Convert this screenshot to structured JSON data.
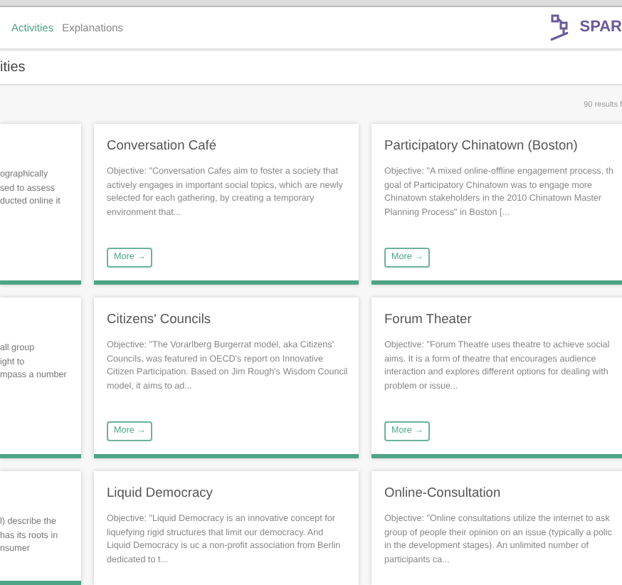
{
  "top_nav": {
    "items": [
      {
        "label": "Activities",
        "selected": true
      },
      {
        "label": "Explanations",
        "selected": false
      }
    ],
    "logo_text": "SPAR"
  },
  "page_title": "ities",
  "results_count": "90 results f",
  "rows": [
    [
      {
        "kind": "clipped",
        "description_lines": [
          "ographically",
          "sed to assess",
          "ducted online it"
        ]
      },
      {
        "kind": "full",
        "title": "Conversation Café",
        "description_lines": [
          "Objective: \"Conversation Cafes aim to foster a society that",
          "actively engages in important social topics, which are newly",
          "selected for each gathering, by creating a temporary",
          "environment that..."
        ],
        "button": "More →"
      },
      {
        "kind": "full",
        "title": "Participatory Chinatown (Boston)",
        "description_lines": [
          "Objective: \"A mixed online-offline engagement process, th",
          "goal of Participatory Chinatown was to engage more",
          "Chinatown stakeholders in the 2010 Chinatown Master",
          "Planning Process\" in Boston [..."
        ],
        "button": "More →"
      }
    ],
    [
      {
        "kind": "clipped",
        "description_lines": [
          "all group",
          "ight to",
          "mpass a number"
        ]
      },
      {
        "kind": "full",
        "title": "Citizens' Councils",
        "description_lines": [
          "Objective: \"The Vorarlberg Burgerrat model, aka Citizens'",
          "Councils, was featured in OECD's report on Innovative",
          "Citizen Participation. Based on Jim Rough's Wisdom Council",
          "model, it aims to ad..."
        ],
        "button": "More →"
      },
      {
        "kind": "full",
        "title": "Forum Theater",
        "description_lines": [
          "Objective: \"Forum Theatre uses theatre to achieve social",
          "aims. It is a form of theatre that encourages audience",
          "interaction and explores different options for dealing with",
          "problem or issue..."
        ],
        "button": "More →"
      }
    ],
    [
      {
        "kind": "clipped",
        "description_lines": [
          "l) describe the",
          "has its roots in",
          "nsumer"
        ]
      },
      {
        "kind": "full",
        "title": "Liquid Democracy",
        "description_lines": [
          "Objective: \"Liquid Democracy is an innovative concept for",
          "liquefying rigid structures that limit our democracy. And",
          "Liquid Democracy is uc a non-profit association from Berlin",
          "dedicated to t..."
        ]
      },
      {
        "kind": "full",
        "title": "Online-Consultation",
        "description_lines": [
          "Objective: \"Online consultations utilize the internet to ask",
          "group of people their opinion on an issue (typically a polic",
          "in the development stages). An unlimited number of",
          "participants ca..."
        ]
      }
    ]
  ]
}
